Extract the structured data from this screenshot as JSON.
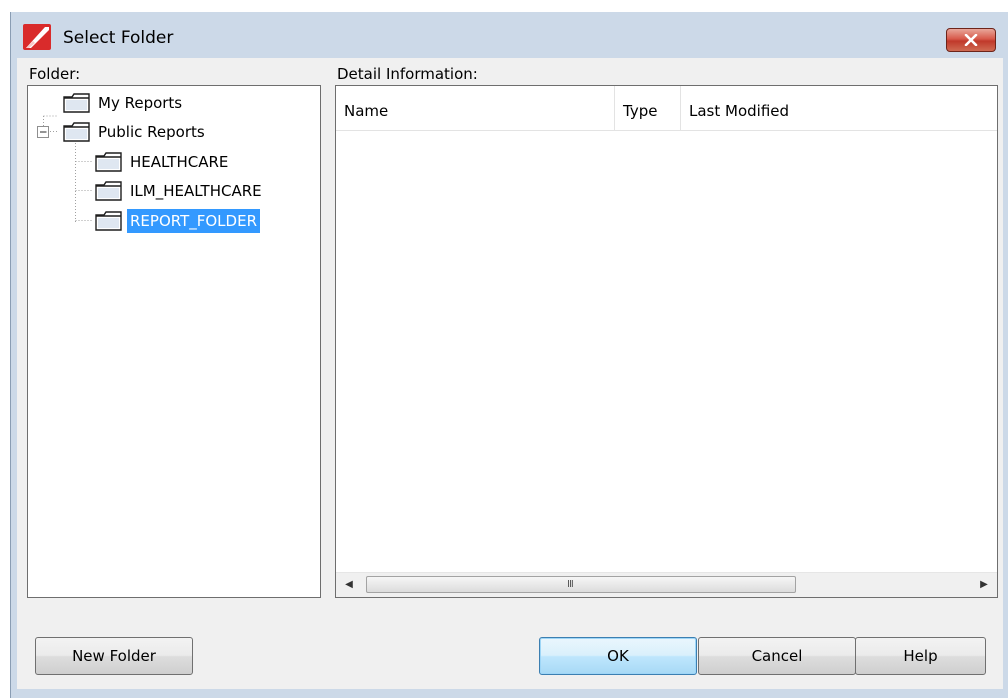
{
  "window": {
    "title": "Select Folder",
    "app_icon": "red-app-logo-icon",
    "close_icon": "close-icon"
  },
  "folder_panel": {
    "label": "Folder:",
    "tree": [
      {
        "label": "My Reports",
        "level": 0,
        "expanded": false,
        "selected": false
      },
      {
        "label": "Public Reports",
        "level": 0,
        "expanded": true,
        "selected": false
      },
      {
        "label": "HEALTHCARE",
        "level": 1,
        "expanded": false,
        "selected": false
      },
      {
        "label": "ILM_HEALTHCARE",
        "level": 1,
        "expanded": false,
        "selected": false
      },
      {
        "label": "REPORT_FOLDER",
        "level": 1,
        "expanded": false,
        "selected": true
      }
    ]
  },
  "detail_panel": {
    "label": "Detail Information:",
    "columns": [
      "Name",
      "Type",
      "Last Modified"
    ],
    "rows": [],
    "scrollbar_grip": "III"
  },
  "buttons": {
    "new_folder": "New Folder",
    "ok": "OK",
    "cancel": "Cancel",
    "help": "Help"
  },
  "colors": {
    "window_frame": "#ccd9e8",
    "selection": "#3399ff",
    "close_button": "#c0392b"
  }
}
